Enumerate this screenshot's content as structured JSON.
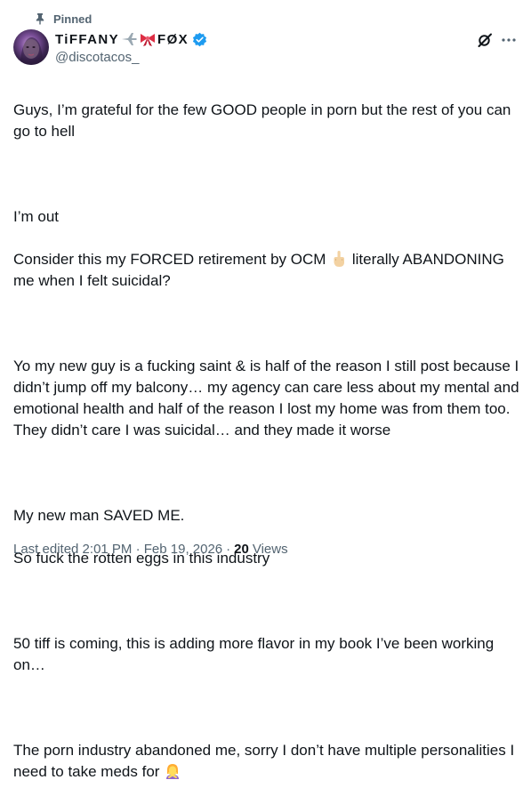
{
  "pinned": {
    "label": "Pinned",
    "icon": "pin-icon"
  },
  "author": {
    "name_part1": "TiFFANY",
    "name_part2": "FØX",
    "emoji_1": "airplane-emoji",
    "emoji_2": "ribbon-emoji",
    "handle": "@discotacos_",
    "verified": true,
    "verified_color": "#1d9bf0"
  },
  "post": {
    "l1": "Guys, I’m grateful for the few GOOD people in porn but the rest of you can go to hell",
    "l2": "I’m out",
    "l3a": "Consider this my FORCED retirement by OCM ",
    "l3b": " literally ABANDONING me when I felt suicidal?",
    "l4": "Yo my new guy is a fucking saint & is half of the reason I still post because I didn’t jump off my balcony… my agency can care less about my mental and emotional health and half of the reason I lost my home was from them too. They didn’t care I was suicidal… and they made it worse",
    "l5": "My new man SAVED ME.",
    "l6": "So fuck the rotten eggs in this industry",
    "l7": "50 tiff is coming, this is adding more flavor in my book I’ve been working on…",
    "l8": "The porn industry abandoned me, sorry I don’t have multiple personalities I need to take meds for ",
    "emoji_finger": "middle-finger-emoji",
    "emoji_shrug": "person-gesturing-no-emoji"
  },
  "meta": {
    "edited": "Last edited 2:01 PM · Feb 19, 2026",
    "sep": "·",
    "views_count": "20",
    "views_label": "Views"
  },
  "colors": {
    "text": "#0f1419",
    "secondary": "#536471",
    "accent": "#1d9bf0"
  }
}
